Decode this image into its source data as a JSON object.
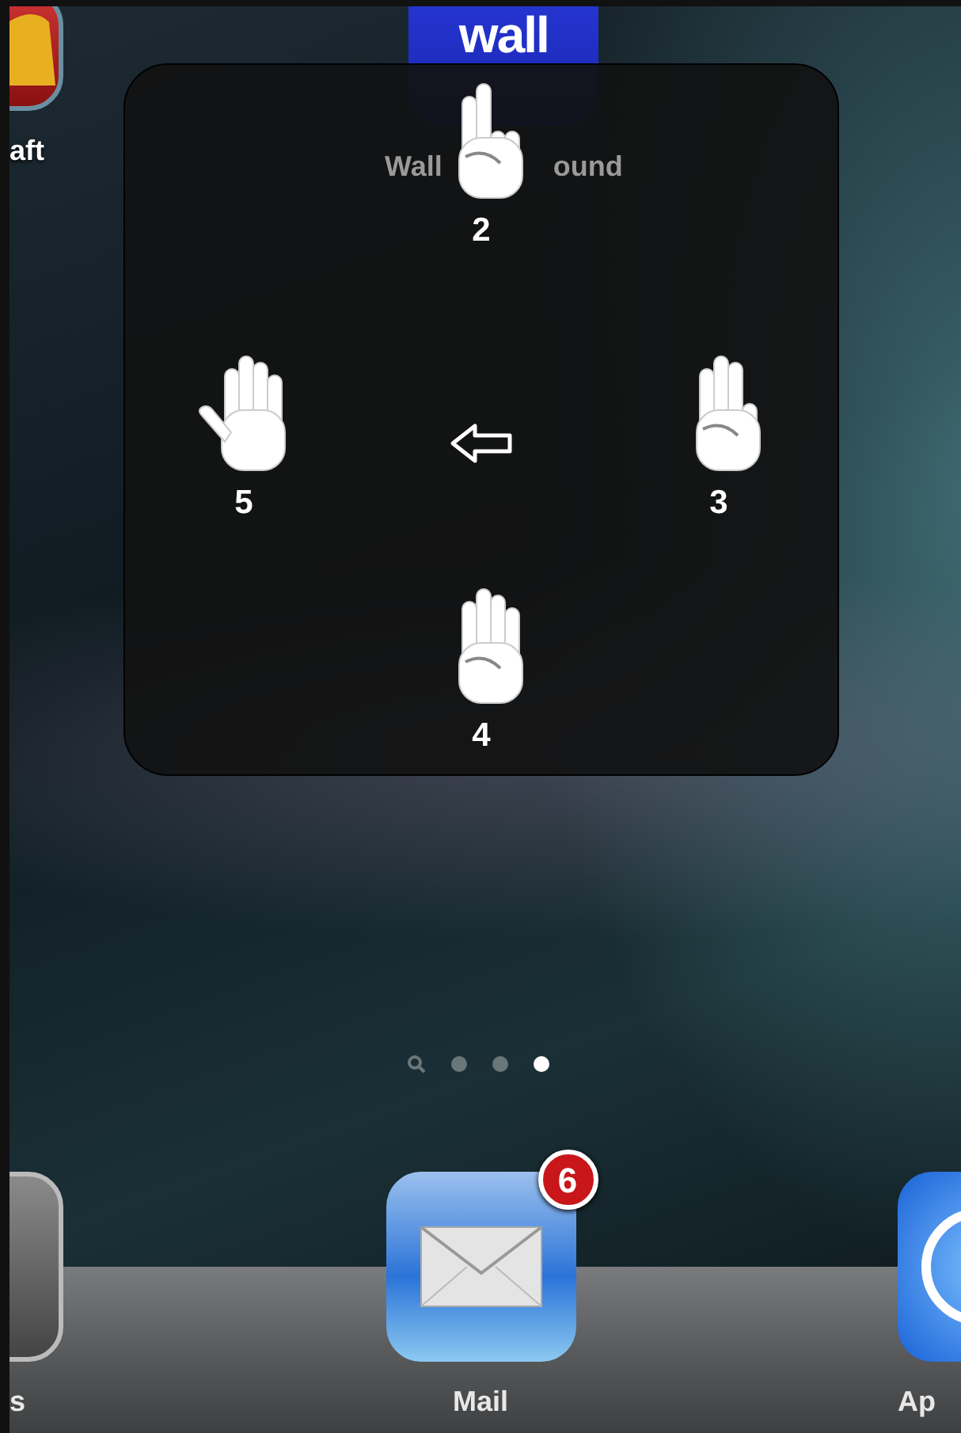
{
  "home_icons": [
    {
      "kind": "bell",
      "label": "aft"
    },
    {
      "kind": "wall",
      "logo": "wall",
      "label_parts": [
        "Wall",
        "ound"
      ]
    }
  ],
  "gesture_overlay": {
    "gestures": [
      {
        "fingers": "2"
      },
      {
        "fingers": "5"
      },
      {
        "fingers": "3"
      },
      {
        "fingers": "4"
      }
    ]
  },
  "page_indicator": {
    "pages": [
      {
        "kind": "search",
        "selected": false
      },
      {
        "kind": "dot",
        "selected": false
      },
      {
        "kind": "dot",
        "selected": false
      },
      {
        "kind": "dot",
        "selected": true
      }
    ]
  },
  "dock": [
    {
      "kind": "gear",
      "label": "s"
    },
    {
      "kind": "mail",
      "label": "Mail",
      "badge": "6"
    },
    {
      "kind": "ring",
      "label": "Ap"
    }
  ]
}
